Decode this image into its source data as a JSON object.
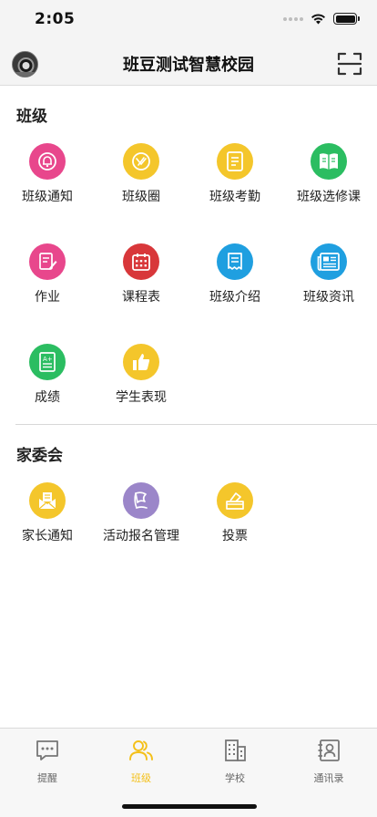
{
  "status_bar": {
    "time": "2:05"
  },
  "header": {
    "title": "班豆测试智慧校园"
  },
  "sections": [
    {
      "title": "班级",
      "items": [
        {
          "label": "班级通知",
          "icon": "bell-icon",
          "color": "#e8478c"
        },
        {
          "label": "班级圈",
          "icon": "circle-share-icon",
          "color": "#f4c62b"
        },
        {
          "label": "班级考勤",
          "icon": "clipboard-icon",
          "color": "#f4c62b"
        },
        {
          "label": "班级选修课",
          "icon": "book-icon",
          "color": "#2bbd61"
        },
        {
          "label": "作业",
          "icon": "edit-document-icon",
          "color": "#e8478c"
        },
        {
          "label": "课程表",
          "icon": "calendar-icon",
          "color": "#d8373a"
        },
        {
          "label": "班级介绍",
          "icon": "scroll-icon",
          "color": "#1f9fe0"
        },
        {
          "label": "班级资讯",
          "icon": "news-icon",
          "color": "#1f9fe0"
        },
        {
          "label": "成绩",
          "icon": "grade-icon",
          "color": "#2bbd61"
        },
        {
          "label": "学生表现",
          "icon": "thumbs-up-icon",
          "color": "#f4c62b"
        }
      ]
    },
    {
      "title": "家委会",
      "items": [
        {
          "label": "家长通知",
          "icon": "envelope-icon",
          "color": "#f4c62b"
        },
        {
          "label": "活动报名管理",
          "icon": "flag-icon",
          "color": "#9b86c9"
        },
        {
          "label": "投票",
          "icon": "ballot-box-icon",
          "color": "#f4c62b"
        }
      ]
    }
  ],
  "tab_bar": {
    "tabs": [
      {
        "label": "提醒",
        "icon": "chat-icon",
        "active": false
      },
      {
        "label": "班级",
        "icon": "users-icon",
        "active": true
      },
      {
        "label": "学校",
        "icon": "building-icon",
        "active": false
      },
      {
        "label": "通讯录",
        "icon": "contacts-icon",
        "active": false
      }
    ],
    "active_color": "#f4c01a"
  }
}
